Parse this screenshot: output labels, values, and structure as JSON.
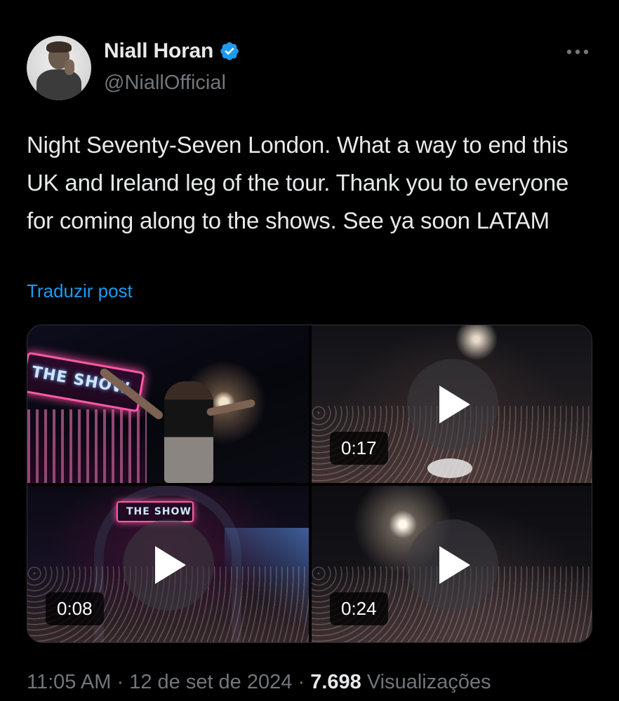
{
  "author": {
    "name": "Niall Horan",
    "handle": "@NiallOfficial",
    "verified": true
  },
  "post": {
    "text": "Night Seventy-Seven London. What a way to end this UK and Ireland leg of the tour. Thank you to everyone for coming along to the shows. See ya soon LATAM",
    "translate_label": "Traduzir post"
  },
  "media": [
    {
      "type": "photo",
      "sign_text": "THE SHOW"
    },
    {
      "type": "video",
      "duration": "0:17"
    },
    {
      "type": "video",
      "duration": "0:08",
      "sign_text": "THE SHOW"
    },
    {
      "type": "video",
      "duration": "0:24"
    }
  ],
  "meta": {
    "time": "11:05 AM",
    "separator": "·",
    "date": "12 de set de 2024",
    "views_count": "7.698",
    "views_label": "Visualizações"
  },
  "colors": {
    "background": "#000000",
    "text": "#e7e9ea",
    "muted": "#71767b",
    "link": "#1d9bf0",
    "verified": "#1d9bf0"
  },
  "icons": {
    "verified": "verified-badge-icon",
    "more": "more-options-icon",
    "play": "play-icon"
  }
}
